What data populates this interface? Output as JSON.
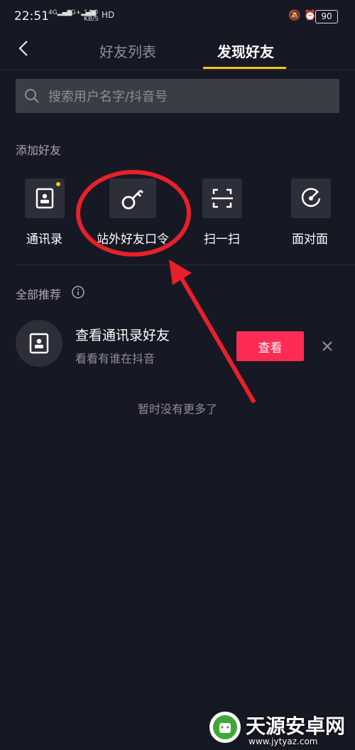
{
  "status_bar": {
    "time": "22:51",
    "signal1": "4G",
    "signal2": "4G+",
    "speed": "14.0",
    "speed_unit": "KB/S",
    "hd": "HD",
    "battery": "90"
  },
  "nav": {
    "tabs": [
      "好友列表",
      "发现好友"
    ],
    "active_tab": "发现好友"
  },
  "search": {
    "placeholder": "搜索用户名字/抖音号"
  },
  "add_friends": {
    "title": "添加好友",
    "items": [
      {
        "label": "通讯录",
        "icon": "contact-card-icon"
      },
      {
        "label": "站外好友口令",
        "icon": "key-icon"
      },
      {
        "label": "扫一扫",
        "icon": "scan-icon"
      },
      {
        "label": "面对面",
        "icon": "radar-icon"
      }
    ]
  },
  "recommend": {
    "title": "全部推荐",
    "item": {
      "title": "查看通讯录好友",
      "subtitle": "看看有谁在抖音",
      "button": "查看"
    },
    "no_more": "暂时没有更多了"
  },
  "watermark": {
    "text": "天源安卓网",
    "url": "www.jytyaz.com"
  },
  "colors": {
    "accent": "#f5c51a",
    "primary_button": "#fe2c55",
    "background": "#161824"
  }
}
